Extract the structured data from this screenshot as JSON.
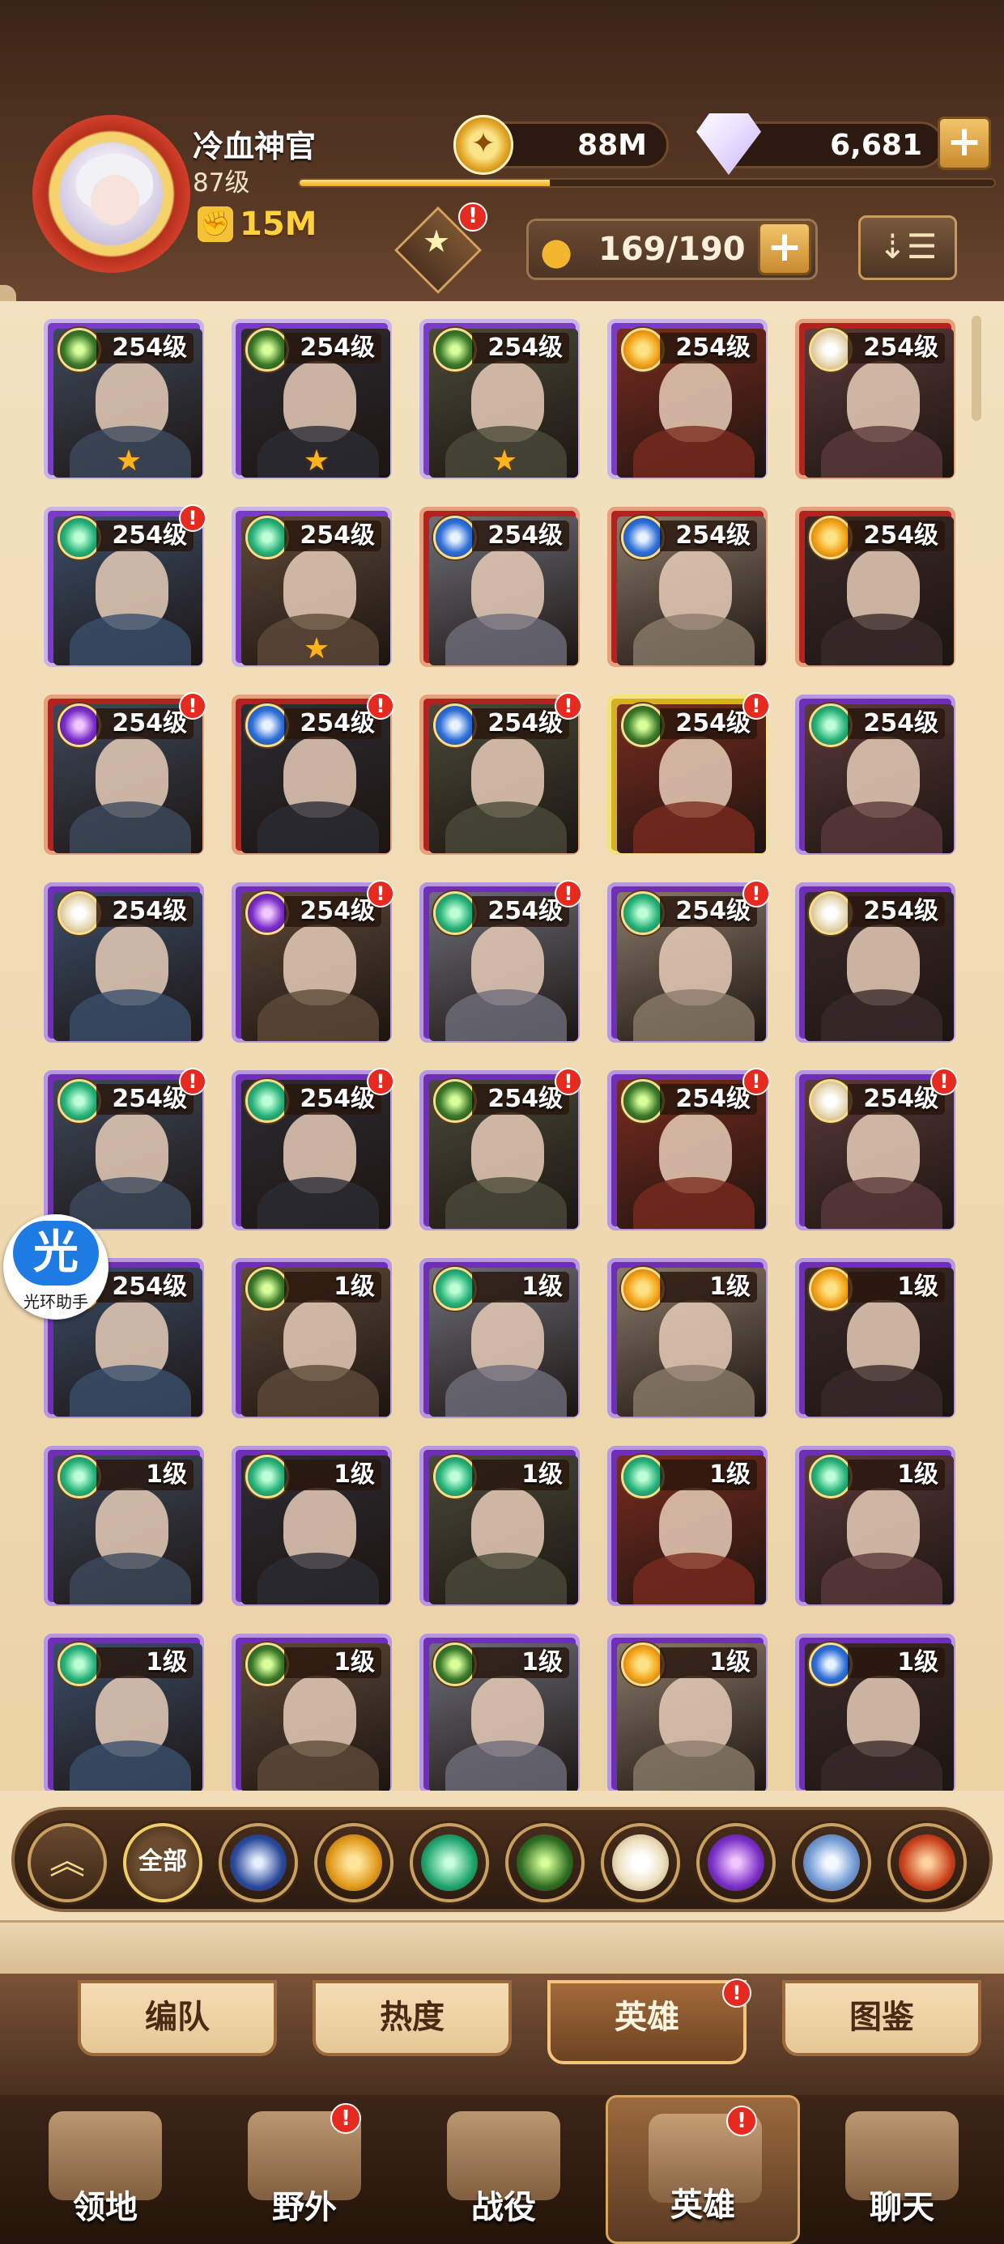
{
  "player": {
    "name": "冷血神官",
    "level": "87级",
    "exp_fraction": 0.36,
    "power": "15M",
    "gold": "88M",
    "diamonds": "6,681"
  },
  "rank_alert": "!",
  "roster": {
    "count": "169/190",
    "add_label": "+",
    "sort_icon": "sort-icon"
  },
  "heroes": [
    {
      "level": "254级",
      "faction": "grave",
      "border": "purple",
      "stars": 1,
      "alert": false
    },
    {
      "level": "254级",
      "faction": "grave",
      "border": "purple",
      "stars": 1,
      "alert": false
    },
    {
      "level": "254级",
      "faction": "grave",
      "border": "purple",
      "stars": 1,
      "alert": false
    },
    {
      "level": "254级",
      "faction": "light",
      "border": "purple",
      "stars": 0,
      "alert": false
    },
    {
      "level": "254级",
      "faction": "celestial",
      "border": "red",
      "stars": 0,
      "alert": false
    },
    {
      "level": "254级",
      "faction": "forest",
      "border": "purple",
      "stars": 0,
      "alert": true
    },
    {
      "level": "254级",
      "faction": "forest",
      "border": "purple",
      "stars": 1,
      "alert": false
    },
    {
      "level": "254级",
      "faction": "tide",
      "border": "red",
      "stars": 0,
      "alert": false
    },
    {
      "level": "254级",
      "faction": "tide",
      "border": "red",
      "stars": 0,
      "alert": false
    },
    {
      "level": "254级",
      "faction": "light",
      "border": "red",
      "stars": 0,
      "alert": false
    },
    {
      "level": "254级",
      "faction": "dark",
      "border": "red",
      "stars": 0,
      "alert": true
    },
    {
      "level": "254级",
      "faction": "tide",
      "border": "red",
      "stars": 0,
      "alert": true
    },
    {
      "level": "254级",
      "faction": "tide",
      "border": "red",
      "stars": 0,
      "alert": true
    },
    {
      "level": "254级",
      "faction": "grave",
      "border": "gold",
      "stars": 0,
      "alert": true
    },
    {
      "level": "254级",
      "faction": "forest",
      "border": "violet",
      "stars": 0,
      "alert": false
    },
    {
      "level": "254级",
      "faction": "celestial",
      "border": "violet",
      "stars": 0,
      "alert": false
    },
    {
      "level": "254级",
      "faction": "dark",
      "border": "violet",
      "stars": 0,
      "alert": true
    },
    {
      "level": "254级",
      "faction": "forest",
      "border": "violet",
      "stars": 0,
      "alert": true
    },
    {
      "level": "254级",
      "faction": "forest",
      "border": "violet",
      "stars": 0,
      "alert": true
    },
    {
      "level": "254级",
      "faction": "celestial",
      "border": "violet",
      "stars": 0,
      "alert": false
    },
    {
      "level": "254级",
      "faction": "forest",
      "border": "violet",
      "stars": 0,
      "alert": true
    },
    {
      "level": "254级",
      "faction": "forest",
      "border": "violet",
      "stars": 0,
      "alert": true
    },
    {
      "level": "254级",
      "faction": "grave",
      "border": "violet",
      "stars": 0,
      "alert": true
    },
    {
      "level": "254级",
      "faction": "grave",
      "border": "violet",
      "stars": 0,
      "alert": true
    },
    {
      "level": "254级",
      "faction": "celestial",
      "border": "violet",
      "stars": 0,
      "alert": true
    },
    {
      "level": "254级",
      "faction": "forest",
      "border": "violet",
      "stars": 0,
      "alert": false
    },
    {
      "level": "1级",
      "faction": "grave",
      "border": "violet",
      "stars": 0,
      "alert": false
    },
    {
      "level": "1级",
      "faction": "forest",
      "border": "violet",
      "stars": 0,
      "alert": false
    },
    {
      "level": "1级",
      "faction": "light",
      "border": "violet",
      "stars": 0,
      "alert": false
    },
    {
      "level": "1级",
      "faction": "light",
      "border": "violet",
      "stars": 0,
      "alert": false
    },
    {
      "level": "1级",
      "faction": "forest",
      "border": "violet",
      "stars": 0,
      "alert": false
    },
    {
      "level": "1级",
      "faction": "forest",
      "border": "violet",
      "stars": 0,
      "alert": false
    },
    {
      "level": "1级",
      "faction": "forest",
      "border": "violet",
      "stars": 0,
      "alert": false
    },
    {
      "level": "1级",
      "faction": "forest",
      "border": "violet",
      "stars": 0,
      "alert": false
    },
    {
      "level": "1级",
      "faction": "forest",
      "border": "violet",
      "stars": 0,
      "alert": false
    },
    {
      "level": "1级",
      "faction": "forest",
      "border": "violet",
      "stars": 0,
      "alert": false
    },
    {
      "level": "1级",
      "faction": "grave",
      "border": "violet",
      "stars": 0,
      "alert": false
    },
    {
      "level": "1级",
      "faction": "grave",
      "border": "violet",
      "stars": 0,
      "alert": false
    },
    {
      "level": "1级",
      "faction": "light",
      "border": "violet",
      "stars": 0,
      "alert": false
    },
    {
      "level": "1级",
      "faction": "tide",
      "border": "violet",
      "stars": 0,
      "alert": false
    }
  ],
  "filters": [
    {
      "name": "filter-collapse-button",
      "label": "",
      "icon": "chevron-up-icon"
    },
    {
      "name": "filter-all-button",
      "label": "全部",
      "icon": ""
    },
    {
      "name": "filter-tide-button",
      "label": "",
      "icon": "tide-faction-icon"
    },
    {
      "name": "filter-light-button",
      "label": "",
      "icon": "light-faction-icon"
    },
    {
      "name": "filter-forest-button",
      "label": "",
      "icon": "forest-faction-icon"
    },
    {
      "name": "filter-grave-button",
      "label": "",
      "icon": "grave-faction-icon"
    },
    {
      "name": "filter-celestial-button",
      "label": "",
      "icon": "celestial-faction-icon"
    },
    {
      "name": "filter-dark-button",
      "label": "",
      "icon": "dark-faction-icon"
    },
    {
      "name": "filter-dimensional-button",
      "label": "",
      "icon": "dimensional-faction-icon"
    },
    {
      "name": "filter-hypogean-button",
      "label": "",
      "icon": "hypogean-faction-icon"
    }
  ],
  "subtabs": [
    {
      "label": "编队",
      "active": false,
      "alert": false
    },
    {
      "label": "热度",
      "active": false,
      "alert": false
    },
    {
      "label": "英雄",
      "active": true,
      "alert": true
    },
    {
      "label": "图鉴",
      "active": false,
      "alert": false
    }
  ],
  "nav": [
    {
      "label": "领地",
      "active": false,
      "alert": false,
      "icon": "castle-icon"
    },
    {
      "label": "野外",
      "active": false,
      "alert": true,
      "icon": "map-scroll-icon"
    },
    {
      "label": "战役",
      "active": false,
      "alert": false,
      "icon": "sword-crest-icon"
    },
    {
      "label": "英雄",
      "active": true,
      "alert": true,
      "icon": "helmet-icon"
    },
    {
      "label": "聊天",
      "active": false,
      "alert": false,
      "icon": "chat-bubble-icon"
    }
  ],
  "helper": {
    "glyph": "光",
    "label": "光环助手"
  },
  "colors": {
    "accent_gold": "#ffd23b",
    "alert_red": "#e62a20",
    "panel_bg": "#f1ddb8"
  }
}
